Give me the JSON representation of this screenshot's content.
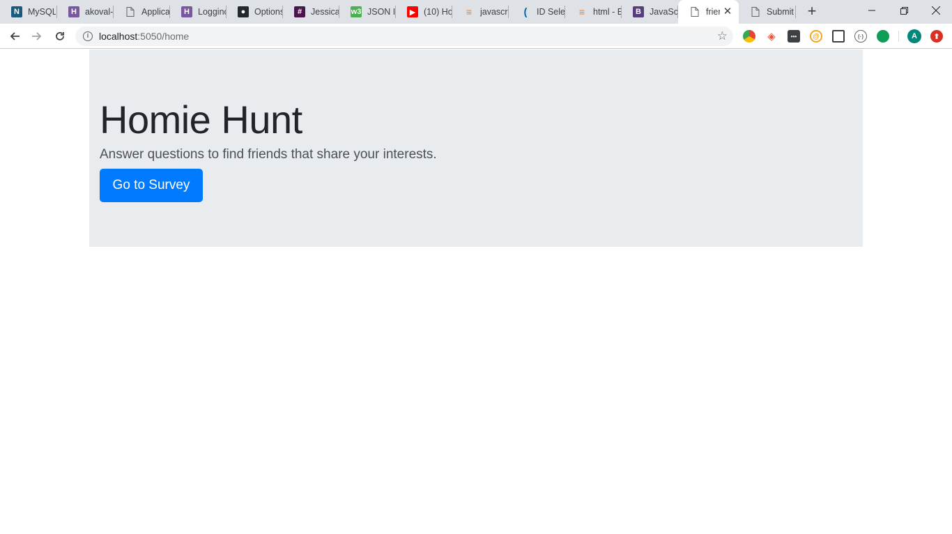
{
  "browser": {
    "tabs": [
      {
        "title": "MySQL",
        "icon": "mysql-icon",
        "color": "#1a5a7a",
        "glyph": "N"
      },
      {
        "title": "akoval-",
        "icon": "heroku-icon",
        "color": "#79589f",
        "glyph": "H"
      },
      {
        "title": "Applica",
        "icon": "document-icon",
        "color": "",
        "glyph": ""
      },
      {
        "title": "Logginc",
        "icon": "heroku-icon",
        "color": "#79589f",
        "glyph": "H"
      },
      {
        "title": "Options",
        "icon": "github-icon",
        "color": "#24292e",
        "glyph": "●"
      },
      {
        "title": "Jessica",
        "icon": "slack-icon",
        "color": "#4a154b",
        "glyph": "#"
      },
      {
        "title": "JSON In",
        "icon": "w3schools-icon",
        "color": "#4caf50",
        "glyph": "w3"
      },
      {
        "title": "(10) Ho",
        "icon": "youtube-icon",
        "color": "#ff0000",
        "glyph": "▶"
      },
      {
        "title": "javascri",
        "icon": "stackoverflow-icon",
        "color": "",
        "glyph": "≡"
      },
      {
        "title": "ID Selec",
        "icon": "jquery-icon",
        "color": "",
        "glyph": "("
      },
      {
        "title": "html - E",
        "icon": "stackoverflow-icon",
        "color": "",
        "glyph": "≡"
      },
      {
        "title": "JavaScr",
        "icon": "bootstrap-icon",
        "color": "#563d7c",
        "glyph": "B"
      },
      {
        "title": "frier",
        "icon": "document-icon",
        "color": "",
        "glyph": "",
        "active": true
      },
      {
        "title": "Submit",
        "icon": "document-icon",
        "color": "",
        "glyph": ""
      }
    ],
    "url_host": "localhost",
    "url_rest": ":5050/home",
    "profile_initial": "A"
  },
  "page": {
    "title": "Homie Hunt",
    "lead": "Answer questions to find friends that share your interests.",
    "button_label": "Go to Survey"
  },
  "colors": {
    "jumbotron_bg": "#e9ecef",
    "primary": "#007bff"
  }
}
